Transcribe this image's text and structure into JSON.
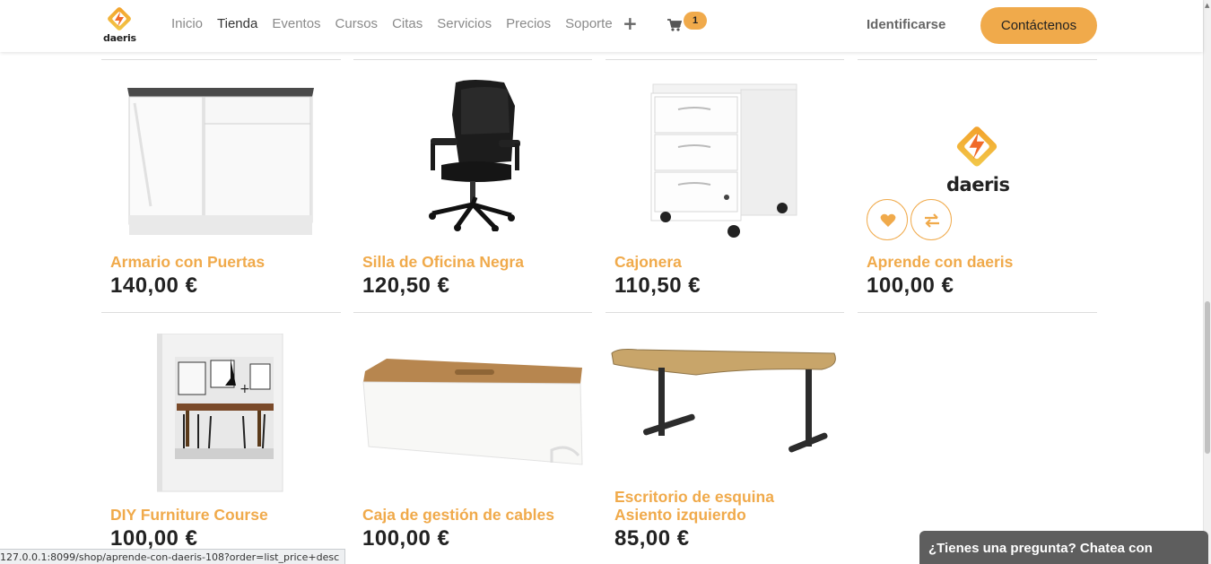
{
  "brand": {
    "name": "daeris",
    "accent": "#f0aa4b"
  },
  "nav": {
    "items": [
      {
        "label": "Inicio",
        "active": false
      },
      {
        "label": "Tienda",
        "active": true
      },
      {
        "label": "Eventos",
        "active": false
      },
      {
        "label": "Cursos",
        "active": false
      },
      {
        "label": "Citas",
        "active": false
      },
      {
        "label": "Servicios",
        "active": false
      },
      {
        "label": "Precios",
        "active": false
      },
      {
        "label": "Soporte",
        "active": false
      }
    ],
    "more_icon": "plus-icon",
    "cart_icon": "shopping-cart-icon",
    "cart_count": "1",
    "signin_label": "Identificarse",
    "contact_label": "Contáctenos"
  },
  "products": [
    {
      "name": "Armario con Puertas",
      "price": "140,00 €"
    },
    {
      "name": "Silla de Oficina Negra",
      "price": "120,50 €"
    },
    {
      "name": "Cajonera",
      "price": "110,50 €"
    },
    {
      "name": "Aprende con daeris",
      "price": "100,00 €",
      "logo_text": "daeris"
    },
    {
      "name": "DIY Furniture Course",
      "price": "100,00 €"
    },
    {
      "name": "Caja de gestión de cables",
      "price": "100,00 €"
    },
    {
      "name": "Escritorio de esquina\nAsiento izquierdo",
      "price": "85,00 €"
    }
  ],
  "chat": {
    "label": "¿Tienes una pregunta? Chatea con nosotros."
  },
  "statusbar": {
    "url": "127.0.0.1:8099/shop/aprende-con-daeris-108?order=list_price+desc"
  }
}
